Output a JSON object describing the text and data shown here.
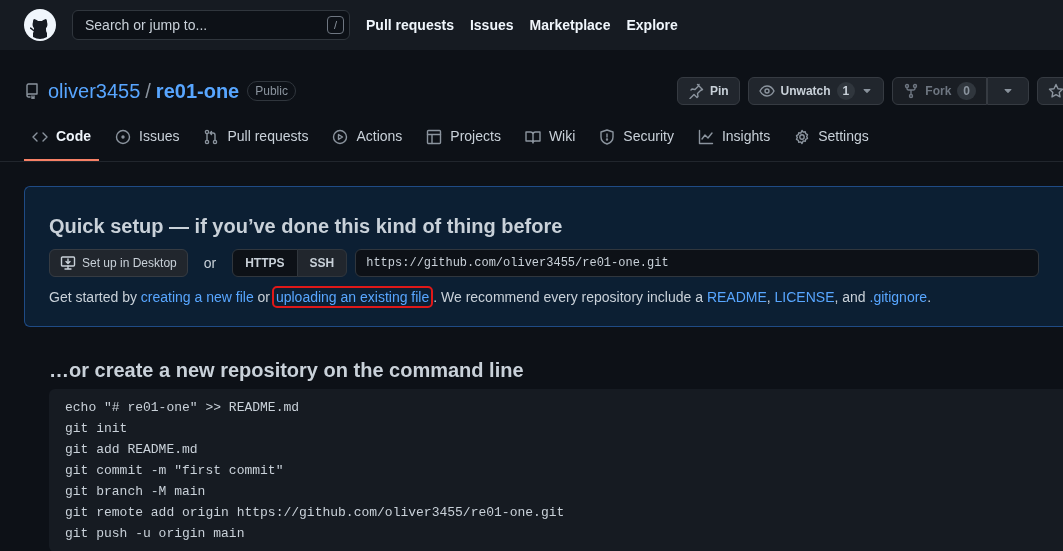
{
  "header": {
    "search_placeholder": "Search or jump to...",
    "search_key": "/",
    "nav": [
      "Pull requests",
      "Issues",
      "Marketplace",
      "Explore"
    ]
  },
  "repo": {
    "owner": "oliver3455",
    "separator": "/",
    "name": "re01-one",
    "visibility": "Public",
    "actions": [
      {
        "kind": "pin",
        "label": "Pin",
        "disabled": false
      },
      {
        "kind": "watch",
        "label": "Unwatch",
        "count": "1",
        "disabled": false
      },
      {
        "kind": "fork",
        "label": "Fork",
        "count": "0",
        "disabled": true
      },
      {
        "kind": "star",
        "disabled": false
      }
    ]
  },
  "tabs": [
    {
      "label": "Code",
      "selected": true
    },
    {
      "label": "Issues",
      "selected": false
    },
    {
      "label": "Pull requests",
      "selected": false
    },
    {
      "label": "Actions",
      "selected": false
    },
    {
      "label": "Projects",
      "selected": false
    },
    {
      "label": "Wiki",
      "selected": false
    },
    {
      "label": "Security",
      "selected": false
    },
    {
      "label": "Insights",
      "selected": false
    },
    {
      "label": "Settings",
      "selected": false
    }
  ],
  "quick_setup": {
    "title": "Quick setup — if you’ve done this kind of thing before",
    "desktop_button": "Set up in Desktop",
    "or": "or",
    "protocols": [
      {
        "label": "HTTPS",
        "selected": true
      },
      {
        "label": "SSH",
        "selected": false
      }
    ],
    "url": "https://github.com/oliver3455/re01-one.git",
    "sentence": [
      {
        "kind": "text",
        "text": "Get started by "
      },
      {
        "kind": "link",
        "text": "creating a new file",
        "highlighted": false
      },
      {
        "kind": "text",
        "text": " or "
      },
      {
        "kind": "link",
        "text": "uploading an existing file",
        "highlighted": true
      },
      {
        "kind": "text",
        "text": ". We recommend every repository include a "
      },
      {
        "kind": "link",
        "text": "README",
        "highlighted": false
      },
      {
        "kind": "text",
        "text": ", "
      },
      {
        "kind": "link",
        "text": "LICENSE",
        "highlighted": false
      },
      {
        "kind": "text",
        "text": ", and "
      },
      {
        "kind": "link",
        "text": ".gitignore",
        "highlighted": false
      },
      {
        "kind": "text",
        "text": "."
      }
    ]
  },
  "command_line": {
    "title": "…or create a new repository on the command line",
    "lines": [
      "echo \"# re01-one\" >> README.md",
      "git init",
      "git add README.md",
      "git commit -m \"first commit\"",
      "git branch -M main",
      "git remote add origin https://github.com/oliver3455/re01-one.git",
      "git push -u origin main"
    ]
  }
}
